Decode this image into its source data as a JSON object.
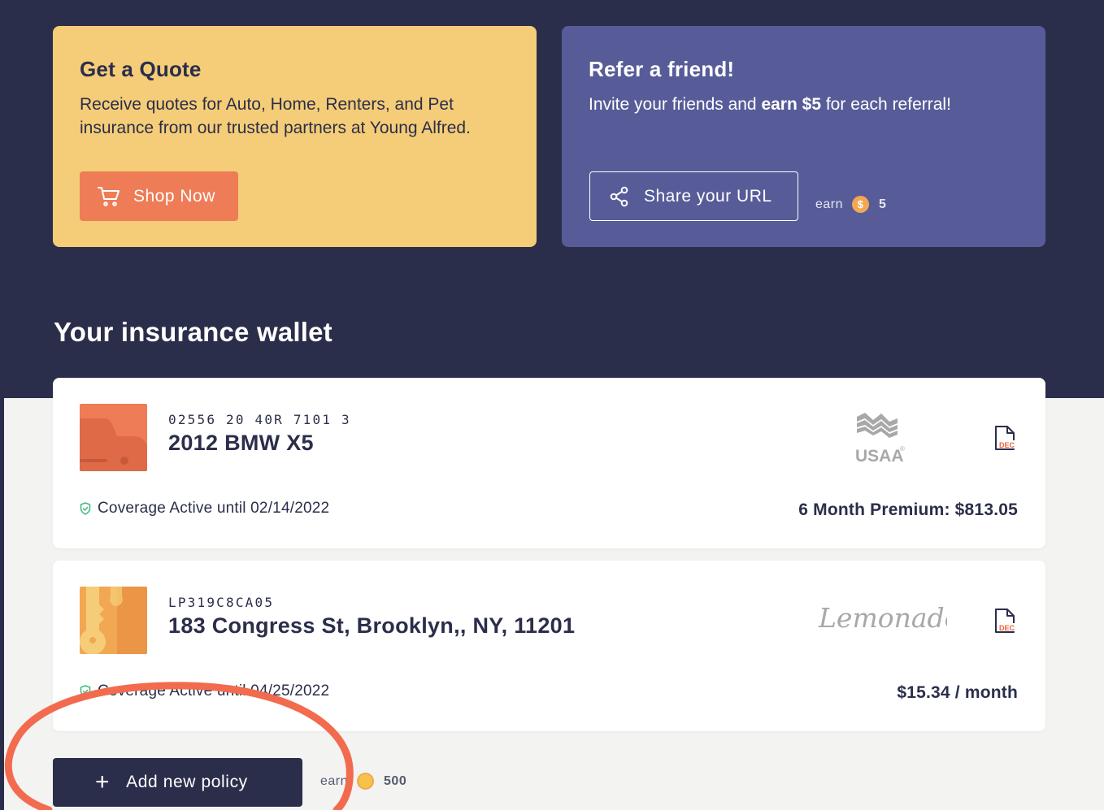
{
  "quote_card": {
    "title": "Get a Quote",
    "text": "Receive quotes for Auto, Home, Renters, and Pet insurance from our trusted partners at Young Alfred.",
    "button_label": "Shop Now",
    "button_icon": "shopping-cart-icon",
    "background": "#f5cd78",
    "button_color": "#ee7c56"
  },
  "refer_card": {
    "title": "Refer a friend!",
    "text_prefix": "Invite your friends and ",
    "text_bold": "earn $5",
    "text_suffix": " for each referral!",
    "button_label": "Share your URL",
    "button_icon": "share-icon",
    "earn_label": "earn",
    "earn_symbol": "$",
    "earn_amount": "5",
    "background": "#575c98"
  },
  "wallet": {
    "title": "Your insurance wallet",
    "policies": [
      {
        "number": "02556 20 40R 7101 3",
        "name": "2012 BMW X5",
        "thumb_icon": "car-icon",
        "carrier": "USAA",
        "carrier_mark": "®",
        "coverage": "Coverage Active until 02/14/2022",
        "premium": "6 Month Premium: $813.05",
        "doc_label": "DEC"
      },
      {
        "number": "LP319C8CA05",
        "name": "183 Congress St, Brooklyn,, NY, 11201",
        "thumb_icon": "keys-icon",
        "carrier": "Lemonade",
        "coverage": "Coverage Active until 04/25/2022",
        "premium": "$15.34 / month",
        "doc_label": "DEC"
      }
    ]
  },
  "add_policy": {
    "button_label": "Add new policy",
    "button_icon": "plus-icon",
    "earn_label": "earn",
    "earn_amount": "500"
  },
  "colors": {
    "navy": "#2b2e4a",
    "page_bg": "#f3f3f1",
    "active_green": "#3dba7a",
    "annotation_circle": "#f26b4f"
  }
}
